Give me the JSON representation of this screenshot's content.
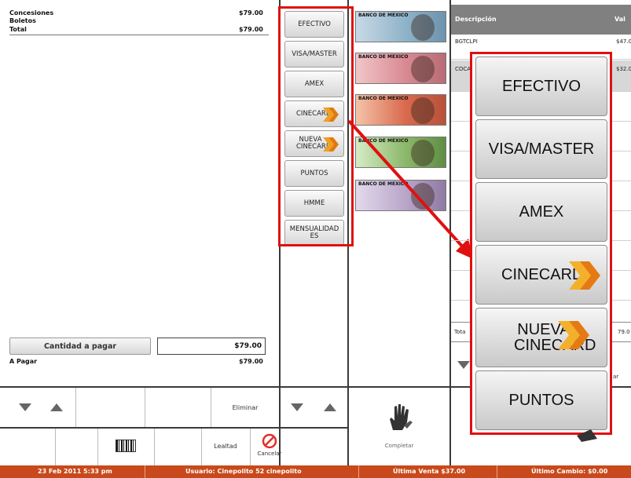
{
  "summary": {
    "rows": [
      {
        "label": "Concesiones",
        "value": "$79.00"
      },
      {
        "label": "Boletos",
        "value": ""
      },
      {
        "label": "Total",
        "value": "$79.00"
      }
    ],
    "cantidad_label": "Cantidad a pagar",
    "cantidad_value": "$79.00",
    "apagar_label": "A Pagar",
    "apagar_value": "$79.00"
  },
  "payment_methods": [
    "EFECTIVO",
    "VISA/MASTER",
    "AMEX",
    "CINECARD",
    "NUEVA CINECARD",
    "PUNTOS",
    "HMME",
    "MENSUALIDADES"
  ],
  "zoom_methods": [
    "EFECTIVO",
    "VISA/MASTER",
    "AMEX",
    "CINECARD",
    "NUEVA CINECARD",
    "PUNTOS"
  ],
  "bills": [
    {
      "header": "BANCO DE MEXICO",
      "color": "#8fb3c9"
    },
    {
      "header": "BANCO DE MEXICO",
      "color": "#d98a93"
    },
    {
      "header": "BANCO DE MEXICO",
      "color": "#d96a4e"
    },
    {
      "header": "BANCO DE MEXICO",
      "color": "#8cb86a"
    },
    {
      "header": "BANCO DE MEXICO",
      "color": "#b9a6c9"
    }
  ],
  "table": {
    "col_desc": "Descripción",
    "col_val": "Val",
    "rows": [
      {
        "desc": "BGTCLPI",
        "val": "$47.0"
      },
      {
        "desc": "COCA",
        "val": "$32.0"
      }
    ],
    "total_label": "Tota",
    "total_val": "79.0",
    "side_text": "ar"
  },
  "controls": {
    "eliminar": "Eliminar",
    "lealtad": "Lealtad",
    "cancelar": "Cancelar",
    "completar": "Completar"
  },
  "status": {
    "date": "23 Feb 2011 5:33 pm",
    "usuario": "Usuario: Cinepolito 52  cinepolito",
    "ultima_venta": "Última Venta  $37.00",
    "ultimo_cambio": "Último Cambio: $0.00"
  },
  "colors": {
    "status_bar": "#c8491b",
    "highlight": "#e01010",
    "table_header": "#808080",
    "chevron": "#e8901c"
  }
}
